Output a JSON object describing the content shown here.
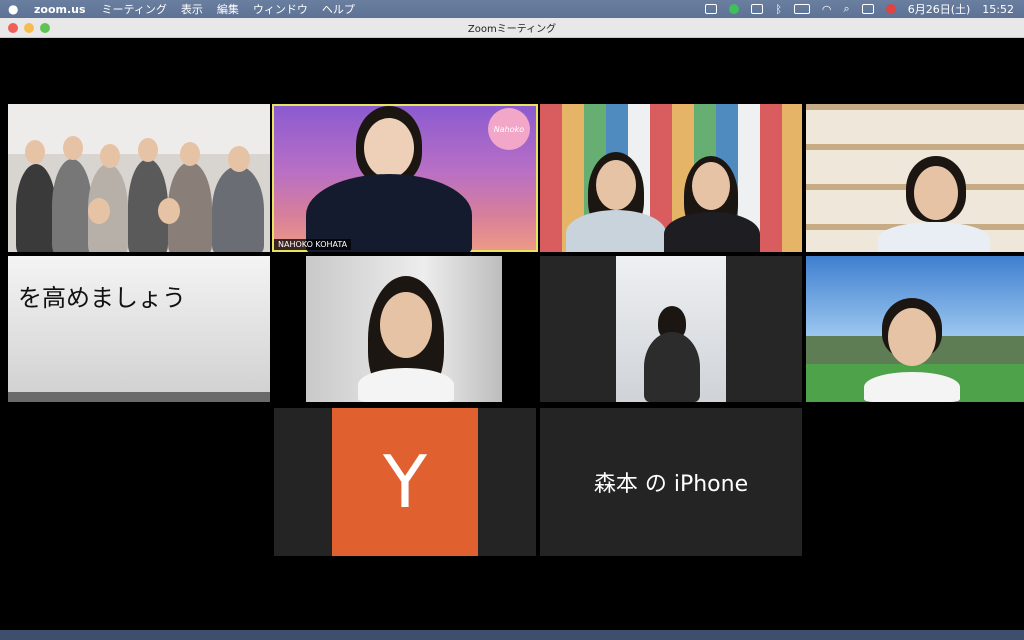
{
  "menubar": {
    "app_name": "zoom.us",
    "menus": [
      "ミーティング",
      "表示",
      "編集",
      "ウィンドウ",
      "ヘルプ"
    ],
    "date_time": "6月26日(土)",
    "clock": "15:52"
  },
  "window": {
    "title": "Zoomミーティング"
  },
  "participants": {
    "nahoko": "NAHOKO KOHATA",
    "avatar_letter": "Y",
    "iphone": "森本 の iPhone"
  },
  "tile_texts": {
    "whiteboard": "を高めましょう",
    "logo": "Nahoko"
  },
  "colors": {
    "avatar_bg": "#e0602f",
    "active_border": "#e7e363"
  }
}
